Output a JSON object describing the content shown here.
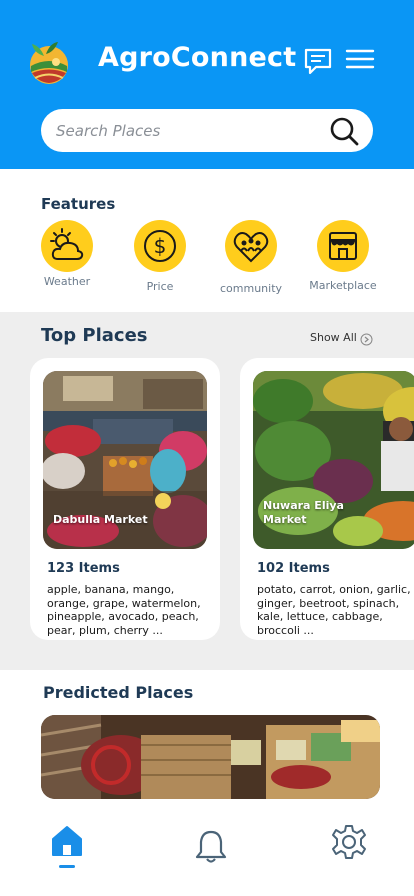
{
  "app": {
    "title": "AgroConnect",
    "brand_color": "#0a96f5",
    "accent_color": "#ffcd1c"
  },
  "header": {
    "logo_icon": "agro-logo",
    "chat_icon": "chat-icon",
    "menu_icon": "hamburger-menu-icon"
  },
  "search": {
    "placeholder": "Search Places",
    "icon": "search-icon"
  },
  "features": {
    "title": "Features",
    "items": [
      {
        "label": "Weather",
        "icon": "weather-icon"
      },
      {
        "label": "Price",
        "icon": "price-icon"
      },
      {
        "label": "community",
        "icon": "community-icon"
      },
      {
        "label": "Marketplace",
        "icon": "marketplace-icon"
      }
    ]
  },
  "top_places": {
    "title": "Top Places",
    "show_all": "Show All",
    "cards": [
      {
        "name": "Dabulla Market",
        "count": "123 Items",
        "items": "apple, banana, mango, orange, grape, watermelon, pineapple, avocado, peach, pear, plum, cherry ..."
      },
      {
        "name": "Nuwara Eliya Market",
        "count": "102 Items",
        "items": "potato, carrot, onion, garlic, ginger, beetroot, spinach, kale, lettuce, cabbage, broccoli ..."
      }
    ]
  },
  "predicted": {
    "title": "Predicted  Places"
  },
  "nav": {
    "items": [
      {
        "name": "home",
        "icon": "home-icon",
        "active": true
      },
      {
        "name": "notifications",
        "icon": "bell-icon",
        "active": false
      },
      {
        "name": "settings",
        "icon": "gear-icon",
        "active": false
      }
    ]
  }
}
